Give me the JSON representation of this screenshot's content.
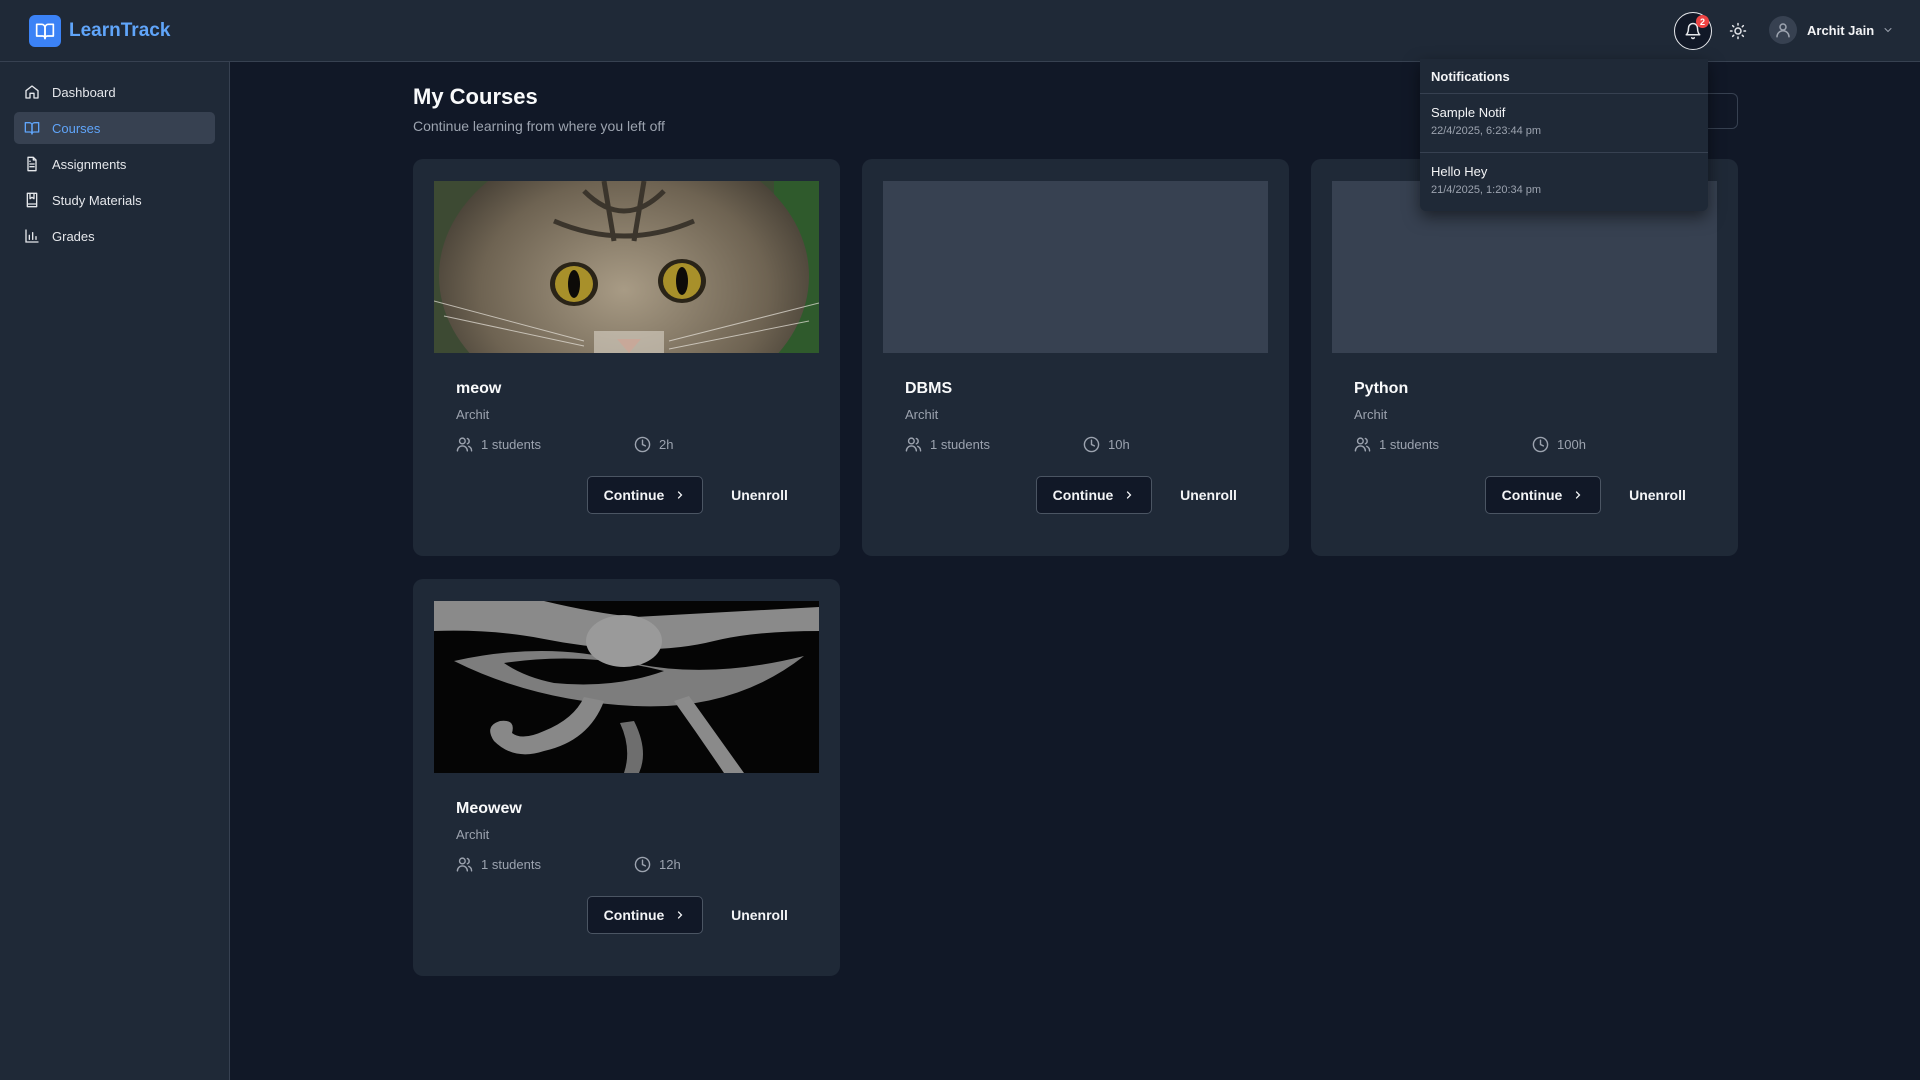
{
  "app": {
    "name": "LearnTrack",
    "accent_color": "#60a5fa",
    "logo_icon": "book-open-icon"
  },
  "header": {
    "notification_count": "2",
    "user_name": "Archit Jain",
    "icons": [
      "bell-icon",
      "sun-icon",
      "user-icon",
      "chevron-down-icon"
    ]
  },
  "sidebar": {
    "items": [
      {
        "label": "Dashboard",
        "icon": "home-icon",
        "active": false
      },
      {
        "label": "Courses",
        "icon": "book-open-icon",
        "active": true
      },
      {
        "label": "Assignments",
        "icon": "file-text-icon",
        "active": false
      },
      {
        "label": "Study Materials",
        "icon": "bookmark-book-icon",
        "active": false
      },
      {
        "label": "Grades",
        "icon": "bar-chart-icon",
        "active": false
      }
    ]
  },
  "main": {
    "title": "My Courses",
    "subtitle": "Continue learning from where you left off",
    "continue_label": "Continue",
    "unenroll_label": "Unenroll",
    "courses": [
      {
        "title": "meow",
        "author": "Archit",
        "students": "1 students",
        "duration": "2h",
        "image": "cat-face-photo"
      },
      {
        "title": "DBMS",
        "author": "Archit",
        "students": "1 students",
        "duration": "10h",
        "image": "placeholder"
      },
      {
        "title": "Python",
        "author": "Archit",
        "students": "1 students",
        "duration": "100h",
        "image": "placeholder"
      },
      {
        "title": "Meowew",
        "author": "Archit",
        "students": "1 students",
        "duration": "12h",
        "image": "eye-of-horus-photo"
      }
    ]
  },
  "notifications": {
    "title": "Notifications",
    "items": [
      {
        "title": "Sample Notif",
        "time": "22/4/2025, 6:23:44 pm"
      },
      {
        "title": "Hello Hey",
        "time": "21/4/2025, 1:20:34 pm"
      }
    ]
  }
}
